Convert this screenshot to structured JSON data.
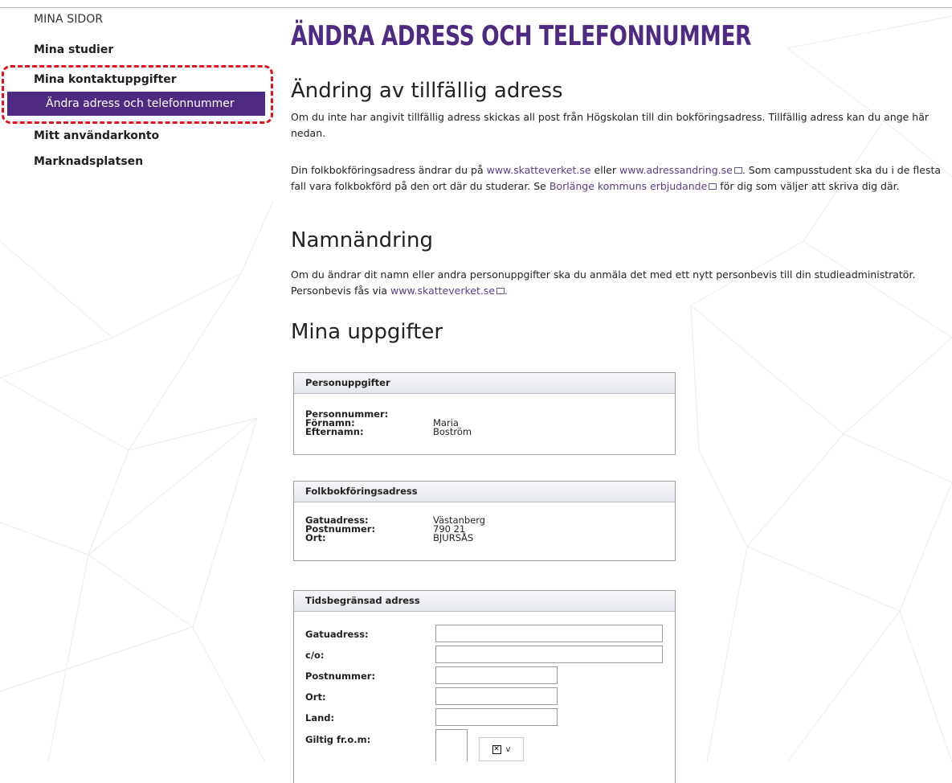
{
  "sidebar": {
    "heading": "MINA SIDOR",
    "items": [
      {
        "label": "Mina studier"
      },
      {
        "label": "Mina kontaktuppgifter"
      },
      {
        "label": "Ändra adress och telefonnummer"
      },
      {
        "label": "Mitt användarkonto"
      },
      {
        "label": "Marknadsplatsen"
      }
    ]
  },
  "main": {
    "title": "ÄNDRA ADRESS OCH TELEFONNUMMER",
    "section1": {
      "heading": "Ändring av tillfällig adress",
      "p1": "Om du inte har angivit tillfällig adress skickas all post från Högskolan till din bokföringsadress. Tillfällig adress kan du ange här nedan.",
      "p2_pre": "Din folkbokföringsadress ändrar du på ",
      "p2_link1": "www.skatteverket.se",
      "p2_mid": " eller ",
      "p2_link2": "www.adressandring.se",
      "p2_post": ". Som campusstudent ska du i de flesta fall vara folkbokförd på den ort där du studerar. Se ",
      "p2_link3": "Borlänge kommuns erbjudande",
      "p2_end": " för dig som väljer att skriva dig där."
    },
    "section2": {
      "heading": "Namnändring",
      "p_pre": "Om du ändrar dit namn eller andra personuppgifter ska du anmäla det med ett nytt personbevis till din studieadministratör. Personbevis fås via ",
      "p_link": "www.skatteverket.se",
      "p_end": "."
    },
    "section3": {
      "heading": "Mina uppgifter"
    }
  },
  "personal": {
    "title": "Personuppgifter",
    "rows": [
      {
        "label": "Personnummer:",
        "value": ""
      },
      {
        "label": "Förnamn:",
        "value": "Maria"
      },
      {
        "label": "Efternamn:",
        "value": "Boström"
      }
    ]
  },
  "registered_address": {
    "title": "Folkbokföringsadress",
    "rows": [
      {
        "label": "Gatuadress:",
        "value": "Västanberg"
      },
      {
        "label": "Postnummer:",
        "value": "790 21"
      },
      {
        "label": "Ort:",
        "value": "BJURSÅS"
      }
    ]
  },
  "temporary_address": {
    "title": "Tidsbegränsad adress",
    "fields": [
      {
        "label": "Gatuadress:",
        "value": ""
      },
      {
        "label": "c/o:",
        "value": ""
      },
      {
        "label": "Postnummer:",
        "value": ""
      },
      {
        "label": "Ort:",
        "value": ""
      },
      {
        "label": "Land:",
        "value": ""
      },
      {
        "label": "Giltig fr.o.m:",
        "value": ""
      }
    ],
    "date_button_glyph": "v"
  },
  "colors": {
    "accent": "#4f2a82",
    "link": "#5a3d8a",
    "highlight_border": "#e3101e"
  }
}
